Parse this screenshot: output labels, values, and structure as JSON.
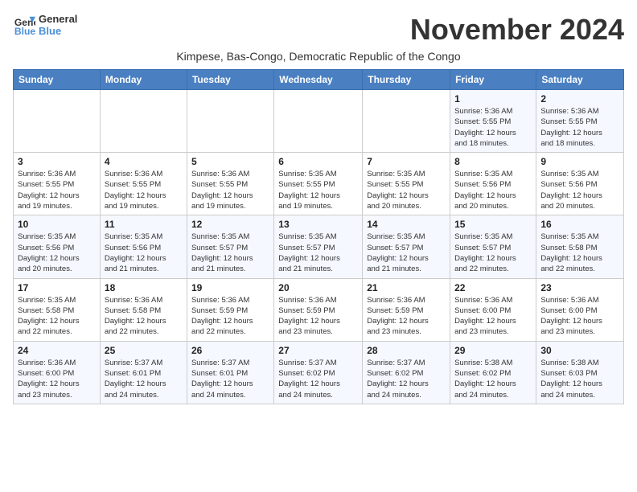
{
  "header": {
    "logo_line1": "General",
    "logo_line2": "Blue",
    "month_title": "November 2024",
    "subtitle": "Kimpese, Bas-Congo, Democratic Republic of the Congo"
  },
  "weekdays": [
    "Sunday",
    "Monday",
    "Tuesday",
    "Wednesday",
    "Thursday",
    "Friday",
    "Saturday"
  ],
  "weeks": [
    [
      {
        "day": "",
        "info": ""
      },
      {
        "day": "",
        "info": ""
      },
      {
        "day": "",
        "info": ""
      },
      {
        "day": "",
        "info": ""
      },
      {
        "day": "",
        "info": ""
      },
      {
        "day": "1",
        "info": "Sunrise: 5:36 AM\nSunset: 5:55 PM\nDaylight: 12 hours\nand 18 minutes."
      },
      {
        "day": "2",
        "info": "Sunrise: 5:36 AM\nSunset: 5:55 PM\nDaylight: 12 hours\nand 18 minutes."
      }
    ],
    [
      {
        "day": "3",
        "info": "Sunrise: 5:36 AM\nSunset: 5:55 PM\nDaylight: 12 hours\nand 19 minutes."
      },
      {
        "day": "4",
        "info": "Sunrise: 5:36 AM\nSunset: 5:55 PM\nDaylight: 12 hours\nand 19 minutes."
      },
      {
        "day": "5",
        "info": "Sunrise: 5:36 AM\nSunset: 5:55 PM\nDaylight: 12 hours\nand 19 minutes."
      },
      {
        "day": "6",
        "info": "Sunrise: 5:35 AM\nSunset: 5:55 PM\nDaylight: 12 hours\nand 19 minutes."
      },
      {
        "day": "7",
        "info": "Sunrise: 5:35 AM\nSunset: 5:55 PM\nDaylight: 12 hours\nand 20 minutes."
      },
      {
        "day": "8",
        "info": "Sunrise: 5:35 AM\nSunset: 5:56 PM\nDaylight: 12 hours\nand 20 minutes."
      },
      {
        "day": "9",
        "info": "Sunrise: 5:35 AM\nSunset: 5:56 PM\nDaylight: 12 hours\nand 20 minutes."
      }
    ],
    [
      {
        "day": "10",
        "info": "Sunrise: 5:35 AM\nSunset: 5:56 PM\nDaylight: 12 hours\nand 20 minutes."
      },
      {
        "day": "11",
        "info": "Sunrise: 5:35 AM\nSunset: 5:56 PM\nDaylight: 12 hours\nand 21 minutes."
      },
      {
        "day": "12",
        "info": "Sunrise: 5:35 AM\nSunset: 5:57 PM\nDaylight: 12 hours\nand 21 minutes."
      },
      {
        "day": "13",
        "info": "Sunrise: 5:35 AM\nSunset: 5:57 PM\nDaylight: 12 hours\nand 21 minutes."
      },
      {
        "day": "14",
        "info": "Sunrise: 5:35 AM\nSunset: 5:57 PM\nDaylight: 12 hours\nand 21 minutes."
      },
      {
        "day": "15",
        "info": "Sunrise: 5:35 AM\nSunset: 5:57 PM\nDaylight: 12 hours\nand 22 minutes."
      },
      {
        "day": "16",
        "info": "Sunrise: 5:35 AM\nSunset: 5:58 PM\nDaylight: 12 hours\nand 22 minutes."
      }
    ],
    [
      {
        "day": "17",
        "info": "Sunrise: 5:35 AM\nSunset: 5:58 PM\nDaylight: 12 hours\nand 22 minutes."
      },
      {
        "day": "18",
        "info": "Sunrise: 5:36 AM\nSunset: 5:58 PM\nDaylight: 12 hours\nand 22 minutes."
      },
      {
        "day": "19",
        "info": "Sunrise: 5:36 AM\nSunset: 5:59 PM\nDaylight: 12 hours\nand 22 minutes."
      },
      {
        "day": "20",
        "info": "Sunrise: 5:36 AM\nSunset: 5:59 PM\nDaylight: 12 hours\nand 23 minutes."
      },
      {
        "day": "21",
        "info": "Sunrise: 5:36 AM\nSunset: 5:59 PM\nDaylight: 12 hours\nand 23 minutes."
      },
      {
        "day": "22",
        "info": "Sunrise: 5:36 AM\nSunset: 6:00 PM\nDaylight: 12 hours\nand 23 minutes."
      },
      {
        "day": "23",
        "info": "Sunrise: 5:36 AM\nSunset: 6:00 PM\nDaylight: 12 hours\nand 23 minutes."
      }
    ],
    [
      {
        "day": "24",
        "info": "Sunrise: 5:36 AM\nSunset: 6:00 PM\nDaylight: 12 hours\nand 23 minutes."
      },
      {
        "day": "25",
        "info": "Sunrise: 5:37 AM\nSunset: 6:01 PM\nDaylight: 12 hours\nand 24 minutes."
      },
      {
        "day": "26",
        "info": "Sunrise: 5:37 AM\nSunset: 6:01 PM\nDaylight: 12 hours\nand 24 minutes."
      },
      {
        "day": "27",
        "info": "Sunrise: 5:37 AM\nSunset: 6:02 PM\nDaylight: 12 hours\nand 24 minutes."
      },
      {
        "day": "28",
        "info": "Sunrise: 5:37 AM\nSunset: 6:02 PM\nDaylight: 12 hours\nand 24 minutes."
      },
      {
        "day": "29",
        "info": "Sunrise: 5:38 AM\nSunset: 6:02 PM\nDaylight: 12 hours\nand 24 minutes."
      },
      {
        "day": "30",
        "info": "Sunrise: 5:38 AM\nSunset: 6:03 PM\nDaylight: 12 hours\nand 24 minutes."
      }
    ]
  ]
}
